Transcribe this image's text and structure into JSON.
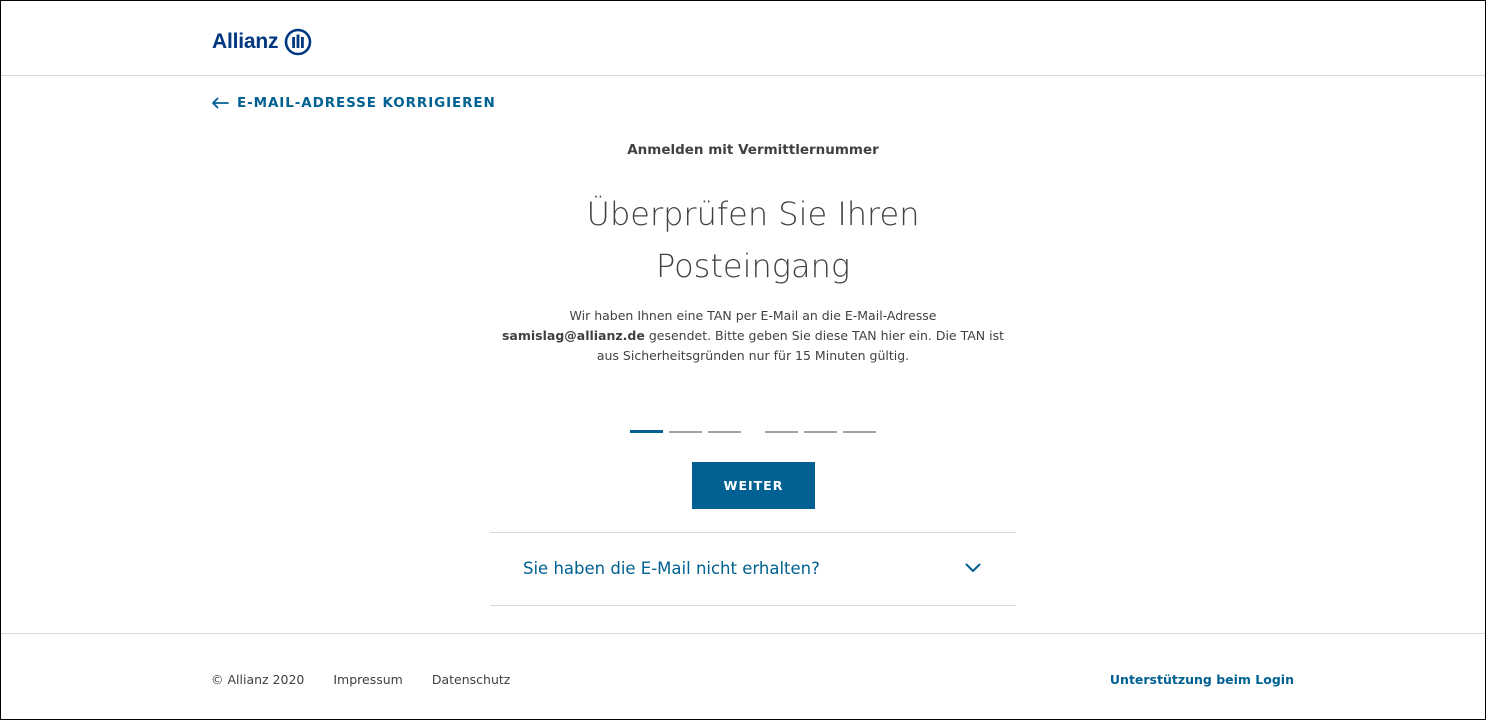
{
  "header": {
    "logo_text": "Allianz"
  },
  "back_link": {
    "label": "E-MAIL-ADRESSE KORRIGIEREN"
  },
  "main": {
    "eyebrow": "Anmelden mit Vermittlernummer",
    "headline_line1": "Überprüfen Sie Ihren",
    "headline_line2": "Posteingang",
    "body_prefix": "Wir haben Ihnen eine TAN per E-Mail an die E-Mail-Adresse",
    "email": "samislag@allianz.de",
    "body_suffix": " gesendet. Bitte geben Sie diese TAN hier ein. Die TAN ist aus Sicherheitsgründen nur für 15 Minuten gültig.",
    "tan_digits": [
      "",
      "",
      "",
      "",
      "",
      ""
    ],
    "submit_label": "WEITER",
    "accordion_label": "Sie haben die E-Mail nicht erhalten?"
  },
  "footer": {
    "copyright": "© Allianz 2020",
    "impressum": "Impressum",
    "datenschutz": "Datenschutz",
    "support": "Unterstützung beim Login"
  },
  "colors": {
    "brand_navy": "#003781",
    "accent_blue": "#006192",
    "text": "#414141",
    "divider": "#d9d9d9"
  },
  "icons": {
    "logo": "allianz-eagle-circle-icon",
    "back": "arrow-left-icon",
    "accordion": "chevron-down-icon"
  }
}
